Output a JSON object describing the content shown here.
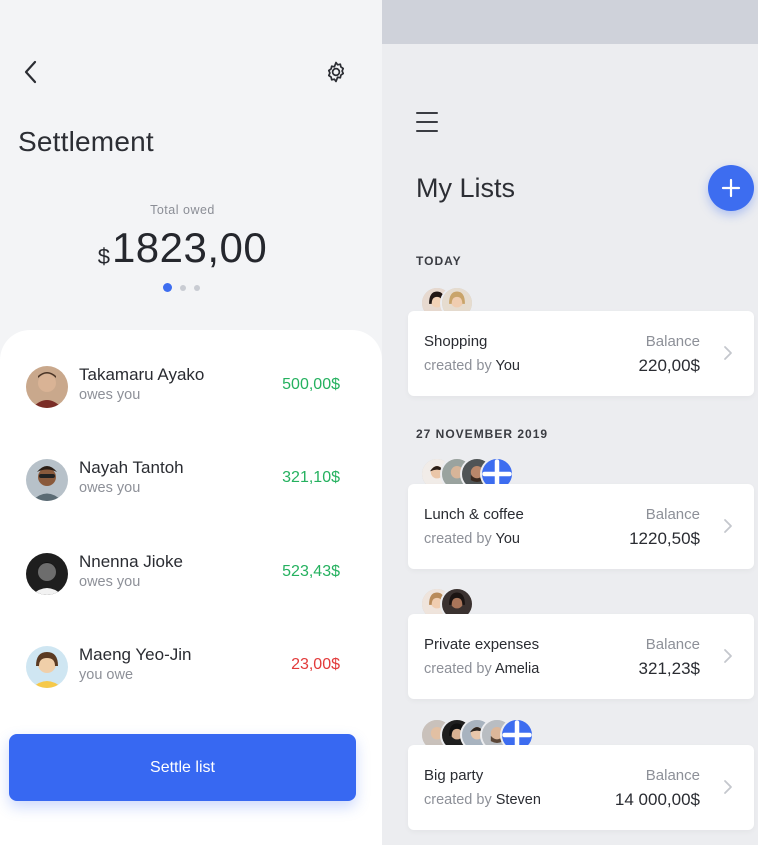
{
  "settlement": {
    "title": "Settlement",
    "total_label": "Total owed",
    "currency": "$",
    "total_amount": "1823,00",
    "pager": {
      "pages": 3,
      "active": 0
    },
    "people": [
      {
        "name": "Takamaru Ayako",
        "status": "owes you",
        "amount": "500,00$",
        "type": "positive"
      },
      {
        "name": "Nayah Tantoh",
        "status": "owes you",
        "amount": "321,10$",
        "type": "positive"
      },
      {
        "name": "Nnenna Jioke",
        "status": "owes you",
        "amount": "523,43$",
        "type": "positive"
      },
      {
        "name": "Maeng Yeo-Jin",
        "status": "you owe",
        "amount": "23,00$",
        "type": "negative"
      }
    ],
    "settle_button": "Settle list"
  },
  "lists": {
    "title": "My Lists",
    "add_icon": "plus-icon",
    "sections": [
      {
        "label": "TODAY"
      },
      {
        "label": "27 NOVEMBER 2019"
      }
    ],
    "balance_label": "Balance",
    "created_by_prefix": "created by",
    "items": [
      {
        "title": "Shopping",
        "creator": "You",
        "balance": "220,00$"
      },
      {
        "title": "Lunch & coffee",
        "creator": "You",
        "balance": "1220,50$"
      },
      {
        "title": "Private expenses",
        "creator": "Amelia",
        "balance": "321,23$"
      },
      {
        "title": "Big party",
        "creator": "Steven",
        "balance": "14 000,00$"
      }
    ]
  },
  "colors": {
    "accent": "#3d6df0",
    "positive": "#25b15f",
    "negative": "#e23a3a"
  }
}
